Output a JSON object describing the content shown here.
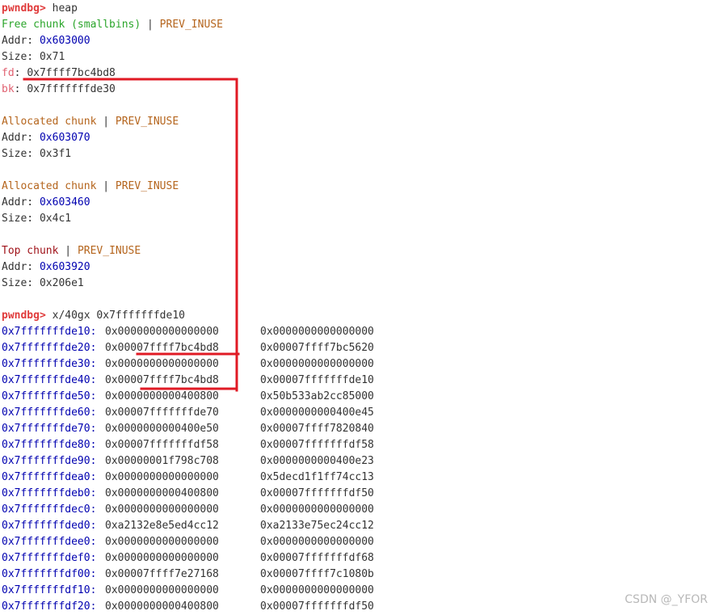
{
  "terminal": {
    "prompt": "pwndbg>",
    "commands": [
      "heap",
      "x/40gx 0x7fffffffde10"
    ],
    "separator": "|",
    "free_chunk": {
      "title": "Free chunk (smallbins)",
      "flag": "PREV_INUSE",
      "addr_label": "Addr:",
      "addr": "0x603000",
      "size_label": "Size:",
      "size": "0x71",
      "fd_label": "fd",
      "fd": "0x7ffff7bc4bd8",
      "bk_label": "bk",
      "bk": "0x7fffffffde30"
    },
    "chunks": [
      {
        "title": "Allocated chunk",
        "flag": "PREV_INUSE",
        "addr_label": "Addr:",
        "addr": "0x603070",
        "size_label": "Size:",
        "size": "0x3f1"
      },
      {
        "title": "Allocated chunk",
        "flag": "PREV_INUSE",
        "addr_label": "Addr:",
        "addr": "0x603460",
        "size_label": "Size:",
        "size": "0x4c1"
      },
      {
        "title": "Top chunk",
        "flag": "PREV_INUSE",
        "addr_label": "Addr:",
        "addr": "0x603920",
        "size_label": "Size:",
        "size": "0x206e1"
      }
    ],
    "memory": [
      {
        "addr": "0x7fffffffde10:",
        "q1": "0x0000000000000000",
        "q2": "0x0000000000000000"
      },
      {
        "addr": "0x7fffffffde20:",
        "q1": "0x00007ffff7bc4bd8",
        "q2": "0x00007ffff7bc5620"
      },
      {
        "addr": "0x7fffffffde30:",
        "q1": "0x0000000000000000",
        "q2": "0x0000000000000000"
      },
      {
        "addr": "0x7fffffffde40:",
        "q1": "0x00007ffff7bc4bd8",
        "q2": "0x00007fffffffde10"
      },
      {
        "addr": "0x7fffffffde50:",
        "q1": "0x0000000000400800",
        "q2": "0x50b533ab2cc85000"
      },
      {
        "addr": "0x7fffffffde60:",
        "q1": "0x00007fffffffde70",
        "q2": "0x0000000000400e45"
      },
      {
        "addr": "0x7fffffffde70:",
        "q1": "0x0000000000400e50",
        "q2": "0x00007ffff7820840"
      },
      {
        "addr": "0x7fffffffde80:",
        "q1": "0x00007fffffffdf58",
        "q2": "0x00007fffffffdf58"
      },
      {
        "addr": "0x7fffffffde90:",
        "q1": "0x00000001f798c708",
        "q2": "0x0000000000400e23"
      },
      {
        "addr": "0x7fffffffdea0:",
        "q1": "0x0000000000000000",
        "q2": "0x5decd1f1ff74cc13"
      },
      {
        "addr": "0x7fffffffdeb0:",
        "q1": "0x0000000000400800",
        "q2": "0x00007fffffffdf50"
      },
      {
        "addr": "0x7fffffffdec0:",
        "q1": "0x0000000000000000",
        "q2": "0x0000000000000000"
      },
      {
        "addr": "0x7fffffffded0:",
        "q1": "0xa2132e8e5ed4cc12",
        "q2": "0xa2133e75ec24cc12"
      },
      {
        "addr": "0x7fffffffdee0:",
        "q1": "0x0000000000000000",
        "q2": "0x0000000000000000"
      },
      {
        "addr": "0x7fffffffdef0:",
        "q1": "0x0000000000000000",
        "q2": "0x00007fffffffdf68"
      },
      {
        "addr": "0x7fffffffdf00:",
        "q1": "0x00007ffff7e27168",
        "q2": "0x00007ffff7c1080b"
      },
      {
        "addr": "0x7fffffffdf10:",
        "q1": "0x0000000000000000",
        "q2": "0x0000000000000000"
      },
      {
        "addr": "0x7fffffffdf20:",
        "q1": "0x0000000000400800",
        "q2": "0x00007fffffffdf50"
      }
    ]
  },
  "annotation_color": "#e01a24",
  "watermark": "CSDN @_YFOR"
}
